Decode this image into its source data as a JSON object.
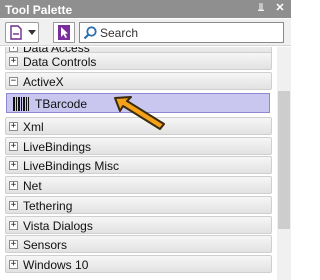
{
  "window": {
    "title": "Tool Palette"
  },
  "titlebar_icons": {
    "pin": "pin-icon",
    "close": "close-icon"
  },
  "toolbar": {
    "categories_icon": "document-icon",
    "cursor_icon": "cursor-icon",
    "search_placeholder": "Search"
  },
  "categories": [
    {
      "label": "Data Access",
      "state": "collapsed"
    },
    {
      "label": "Data Controls",
      "state": "collapsed"
    },
    {
      "label": "ActiveX",
      "state": "expanded"
    },
    {
      "label": "Xml",
      "state": "collapsed"
    },
    {
      "label": "LiveBindings",
      "state": "collapsed"
    },
    {
      "label": "LiveBindings Misc",
      "state": "collapsed"
    },
    {
      "label": "Net",
      "state": "collapsed"
    },
    {
      "label": "Tethering",
      "state": "collapsed"
    },
    {
      "label": "Vista Dialogs",
      "state": "collapsed"
    },
    {
      "label": "Sensors",
      "state": "collapsed"
    },
    {
      "label": "Windows 10",
      "state": "collapsed"
    }
  ],
  "expand_glyph": "+",
  "collapse_glyph": "−",
  "selected_item": {
    "label": "TBarcode",
    "icon": "barcode-icon"
  },
  "annotation": {
    "icon": "orange-arrow-icon",
    "color": "#f5a21a"
  },
  "colors": {
    "selection": "#c9c7ef",
    "selection_border": "#8d88cf",
    "titlebar": "#8f8f8f"
  }
}
